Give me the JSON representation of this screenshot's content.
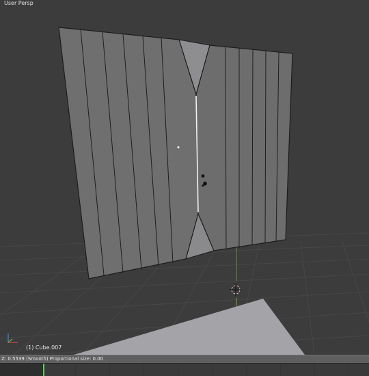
{
  "viewport": {
    "view_name": "User Persp",
    "object_name": "(1) Cube.007"
  },
  "status": {
    "header_text": "Z: 0.5539 (Smooth) Proportional size: 0.00"
  },
  "colors": {
    "background": "#3c3c3c",
    "grid": "#4a4a4a",
    "mesh_face": "#6f6f70",
    "mesh_edge": "#1c1c1c",
    "selected_edge": "#f2f2f2",
    "axis_x": "#b8464a",
    "axis_y": "#6fa93a",
    "timeline_frame": "#5ad14f"
  },
  "icons": [
    "3d-cursor-icon",
    "axis-gizmo-icon",
    "pivot-point-icon"
  ]
}
